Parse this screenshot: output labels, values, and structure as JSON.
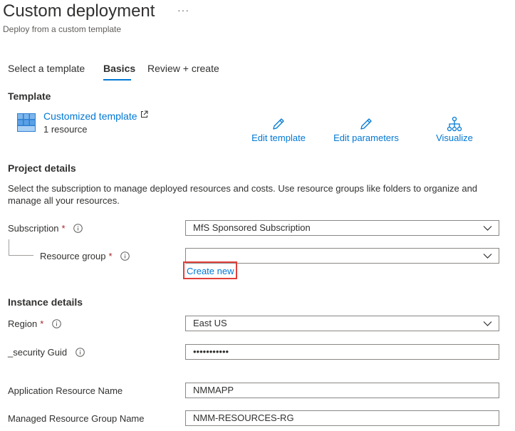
{
  "header": {
    "title": "Custom deployment",
    "more": "···",
    "subtitle": "Deploy from a custom template"
  },
  "tabs": [
    {
      "label": "Select a template"
    },
    {
      "label": "Basics"
    },
    {
      "label": "Review + create"
    }
  ],
  "template": {
    "section": "Template",
    "link": "Customized template",
    "resources": "1 resource",
    "actions": {
      "edit_template": "Edit template",
      "edit_parameters": "Edit parameters",
      "visualize": "Visualize"
    }
  },
  "project": {
    "section": "Project details",
    "description": "Select the subscription to manage deployed resources and costs. Use resource groups like folders to organize and manage all your resources.",
    "subscription_label": "Subscription",
    "subscription_value": "MfS Sponsored Subscription",
    "resource_group_label": "Resource group",
    "resource_group_value": "",
    "create_new": "Create new",
    "required_mark": "*"
  },
  "instance": {
    "section": "Instance details",
    "region_label": "Region",
    "region_value": "East US",
    "security_guid_label": "_security Guid",
    "security_guid_value": "•••••••••••",
    "app_name_label": "Application Resource Name",
    "app_name_value": "NMMAPP",
    "managed_rg_label": "Managed Resource Group Name",
    "managed_rg_value": "NMM-RESOURCES-RG"
  },
  "colors": {
    "accent": "#0078d4",
    "required": "#a4262c",
    "highlight": "#e0403a",
    "border": "#8a8886"
  }
}
